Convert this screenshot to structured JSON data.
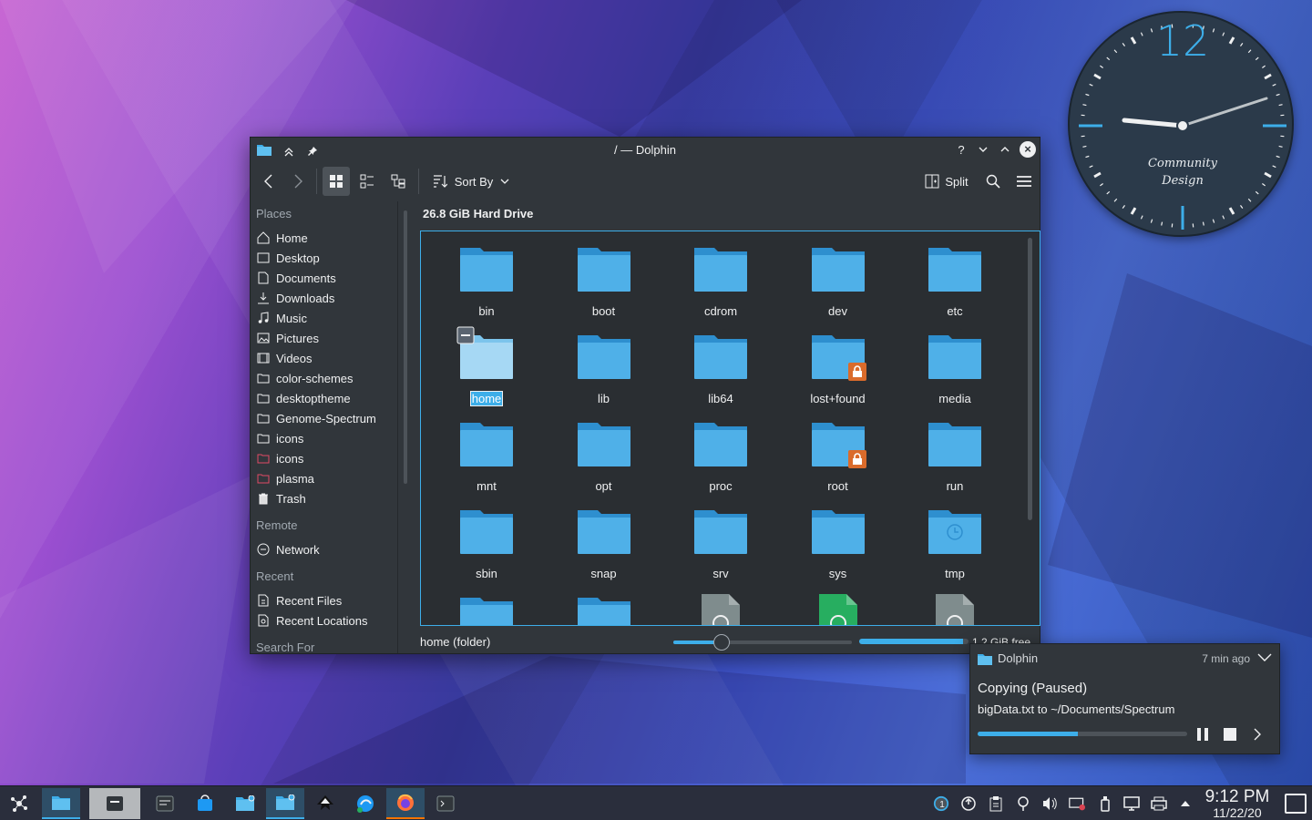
{
  "wallpaper": {
    "primary": "#3b3faa",
    "accent": "#c45ed0"
  },
  "clock": {
    "hour_label": "12",
    "brand_line1": "Community",
    "brand_line2": "Design",
    "accent": "#3daee9"
  },
  "window": {
    "title": "/ — Dolphin",
    "toolbar": {
      "sort_label": "Sort By",
      "split_label": "Split"
    },
    "sidebar": {
      "places_header": "Places",
      "places": [
        {
          "label": "Home",
          "icon": "home-icon"
        },
        {
          "label": "Desktop",
          "icon": "desktop-icon"
        },
        {
          "label": "Documents",
          "icon": "documents-icon"
        },
        {
          "label": "Downloads",
          "icon": "downloads-icon"
        },
        {
          "label": "Music",
          "icon": "music-icon"
        },
        {
          "label": "Pictures",
          "icon": "pictures-icon"
        },
        {
          "label": "Videos",
          "icon": "videos-icon"
        },
        {
          "label": "color-schemes",
          "icon": "folder-icon"
        },
        {
          "label": "desktoptheme",
          "icon": "folder-icon"
        },
        {
          "label": "Genome-Spectrum",
          "icon": "folder-icon"
        },
        {
          "label": "icons",
          "icon": "folder-icon"
        },
        {
          "label": "icons",
          "icon": "folder-red-icon"
        },
        {
          "label": "plasma",
          "icon": "folder-red-icon"
        },
        {
          "label": "Trash",
          "icon": "trash-icon"
        }
      ],
      "remote_header": "Remote",
      "remote": [
        {
          "label": "Network",
          "icon": "network-icon"
        }
      ],
      "recent_header": "Recent",
      "recent": [
        {
          "label": "Recent Files",
          "icon": "recent-files-icon"
        },
        {
          "label": "Recent Locations",
          "icon": "recent-locations-icon"
        }
      ],
      "search_header": "Search For"
    },
    "location_header": "26.8 GiB Hard Drive",
    "items": [
      {
        "name": "bin"
      },
      {
        "name": "boot"
      },
      {
        "name": "cdrom"
      },
      {
        "name": "dev"
      },
      {
        "name": "etc"
      },
      {
        "name": "home",
        "selected": true
      },
      {
        "name": "lib"
      },
      {
        "name": "lib64"
      },
      {
        "name": "lost+found",
        "locked": true
      },
      {
        "name": "media"
      },
      {
        "name": "mnt"
      },
      {
        "name": "opt"
      },
      {
        "name": "proc"
      },
      {
        "name": "root",
        "locked": true
      },
      {
        "name": "run"
      },
      {
        "name": "sbin"
      },
      {
        "name": "snap"
      },
      {
        "name": "srv"
      },
      {
        "name": "sys"
      },
      {
        "name": "tmp",
        "badge": "clock"
      }
    ],
    "status": {
      "selection": "home (folder)",
      "free_space": "1.2 GiB free",
      "used_fraction": 0.95,
      "zoom_fraction": 0.27
    }
  },
  "notification": {
    "app": "Dolphin",
    "time": "7 min ago",
    "title": "Copying (Paused)",
    "body": "bigData.txt to ~/Documents/Spectrum",
    "progress": 0.48
  },
  "taskbar": {
    "apps": [
      {
        "name": "application-launcher"
      },
      {
        "name": "dolphin-files"
      },
      {
        "name": "terminal-konsole"
      },
      {
        "name": "system-settings"
      },
      {
        "name": "discover-store"
      },
      {
        "name": "dolphin-window"
      },
      {
        "name": "dolphin-window-active"
      },
      {
        "name": "inkscape"
      },
      {
        "name": "kde-connect"
      },
      {
        "name": "firefox"
      },
      {
        "name": "terminal"
      }
    ],
    "tray_badge": "1",
    "time": "9:12 PM",
    "date": "11/22/20"
  }
}
